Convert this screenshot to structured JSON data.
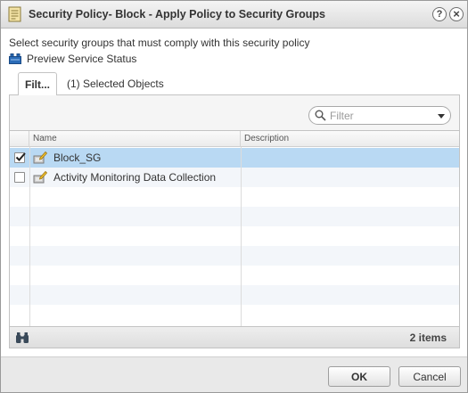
{
  "dialog": {
    "title": "Security Policy- Block - Apply Policy to Security Groups",
    "help_glyph": "?",
    "close_glyph": "×",
    "title_icon": "policy-document-icon"
  },
  "instruction": "Select security groups that must comply with this security policy",
  "preview_link": {
    "label": "Preview Service Status",
    "icon": "service-status-icon"
  },
  "tabs": [
    {
      "label": "Filt...",
      "active": true
    },
    {
      "label": "(1) Selected Objects",
      "active": false
    }
  ],
  "filter": {
    "placeholder": "Filter",
    "value": ""
  },
  "grid": {
    "columns": [
      "",
      "Name",
      "Description"
    ],
    "rows": [
      {
        "checked": true,
        "name": "Block_SG",
        "description": "",
        "selected": true
      },
      {
        "checked": false,
        "name": "Activity Monitoring Data Collection",
        "description": "",
        "selected": false
      }
    ],
    "item_count": "2 items"
  },
  "buttons": {
    "ok": "OK",
    "cancel": "Cancel"
  },
  "colors": {
    "selection": "#b9d9f3",
    "accent": "#1f6fb5"
  }
}
